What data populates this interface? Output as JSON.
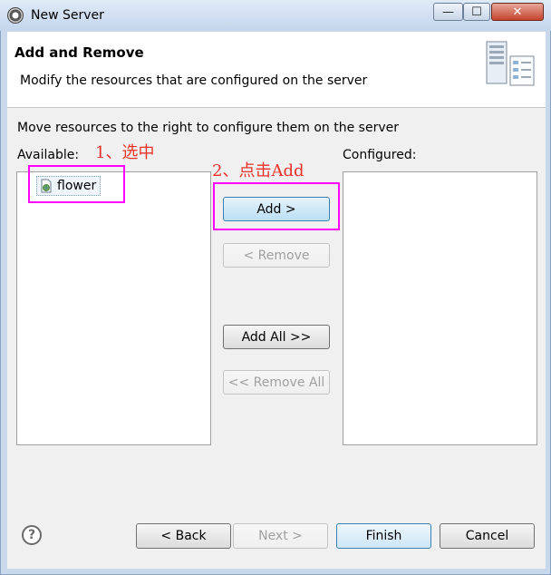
{
  "window": {
    "title": "New Server",
    "minimize": "—",
    "maximize": "☐",
    "close": "✕"
  },
  "header": {
    "title": "Add and Remove",
    "description": "Modify the resources that are configured on the server"
  },
  "instruction": "Move resources to the right to configure them on the server",
  "available": {
    "label": "Available:",
    "items": [
      {
        "label": "flower",
        "selected": true
      }
    ]
  },
  "configured": {
    "label": "Configured:",
    "items": []
  },
  "buttons": {
    "add": "Add >",
    "remove": "< Remove",
    "add_all": "Add All >>",
    "remove_all": "<< Remove All"
  },
  "footer": {
    "help": "?",
    "back": "< Back",
    "next": "Next >",
    "finish": "Finish",
    "cancel": "Cancel"
  },
  "annotations": {
    "step1": "1、选中",
    "step2": "2、点击Add",
    "color": "#ff00ff",
    "text_color": "#e8322b"
  }
}
